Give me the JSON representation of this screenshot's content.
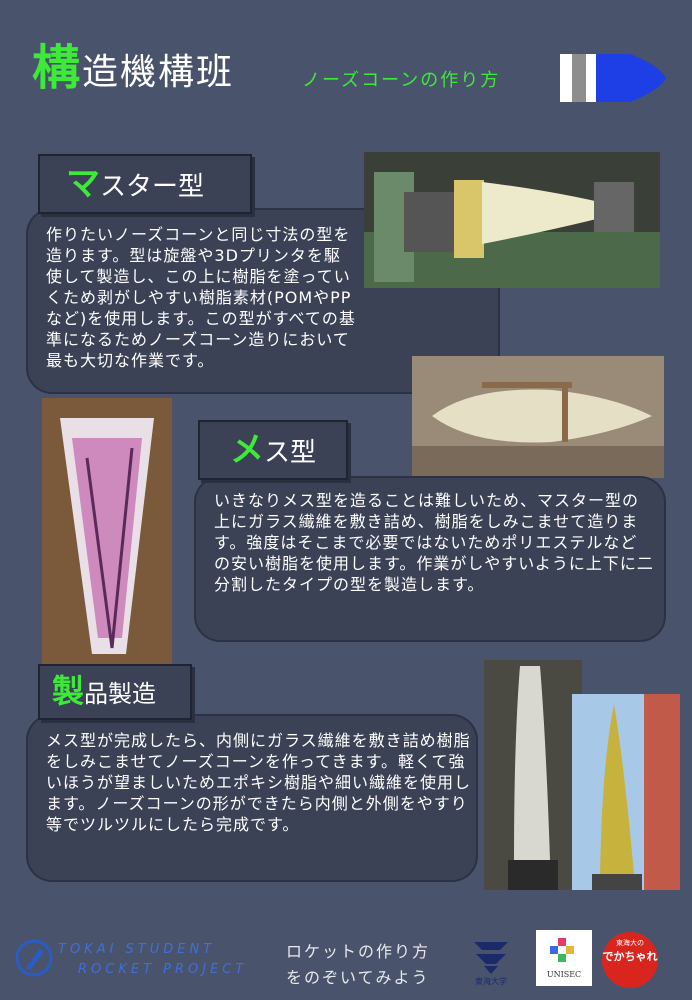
{
  "header": {
    "title_accent": "構",
    "title_rest": "造機構班",
    "subtitle": "ノーズコーンの作り方"
  },
  "sections": [
    {
      "heading_accent": "マ",
      "heading_rest": "スター型",
      "body": "作りたいノーズコーンと同じ寸法の型を造ります。型は旋盤や3Dプリンタを駆使して製造し、この上に樹脂を塗っていくため剥がしやすい樹脂素材(POMやPPなど)を使用します。この型がすべての基準になるためノーズコーン造りにおいて最も大切な作業です。"
    },
    {
      "heading_accent": "メ",
      "heading_rest": "ス型",
      "body": "いきなりメス型を造ることは難しいため、マスター型の上にガラス繊維を敷き詰め、樹脂をしみこませて造ります。強度はそこまで必要ではないためポリエステルなどの安い樹脂を使用します。作業がしやすいように上下に二分割したタイプの型を製造します。"
    },
    {
      "heading_accent": "製",
      "heading_rest": "品製造",
      "body": "メス型が完成したら、内側にガラス繊維を敷き詰め樹脂をしみこませてノーズコーンを作ってきます。軽くて強いほうが望ましいためエポキシ樹脂や細い繊維を使用します。ノーズコーンの形ができたら内側と外側をやすり等でツルツルにしたら完成です。"
    }
  ],
  "footer": {
    "logo_line1": "TOKAI STUDENT",
    "logo_line2": "ROCKET PROJECT",
    "tagline1": "ロケットの作り方",
    "tagline2": "をのぞいてみよう",
    "university": "東海大学",
    "unisec": "UNISEC",
    "dekachare_small": "東海大の",
    "dekachare_big": "でかちゃれ"
  },
  "colors": {
    "background": "#49546c",
    "accent": "#3ee93a",
    "rocket_blue": "#1e3ee6"
  }
}
